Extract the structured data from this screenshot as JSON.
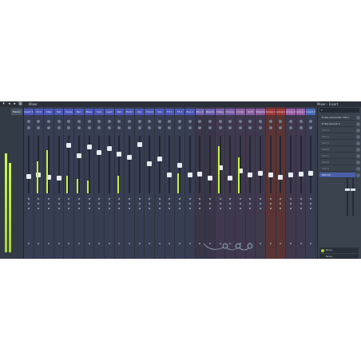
{
  "app": {
    "title": "Mixer",
    "fx_panel_title": "Mixer - Insert"
  },
  "master": {
    "label": "Master"
  },
  "tracks": [
    {
      "name": "Insert 1",
      "color": "#4a58b8",
      "fader": 0.28,
      "peak": 0.0
    },
    {
      "name": "Kick",
      "color": "#4a58b8",
      "fader": 0.3,
      "peak": 0.55
    },
    {
      "name": "Clap",
      "color": "#4a58b8",
      "fader": 0.26,
      "peak": 0.75
    },
    {
      "name": "Hat",
      "color": "#4a58b8",
      "fader": 0.25,
      "peak": 0.0
    },
    {
      "name": "Snare",
      "color": "#4a58b8",
      "fader": 0.86,
      "peak": 0.3
    },
    {
      "name": "Perc",
      "color": "#4a58b8",
      "fader": 0.66,
      "peak": 0.25
    },
    {
      "name": "Bass",
      "color": "#4a58b8",
      "fader": 0.84,
      "peak": 0.22
    },
    {
      "name": "Sub",
      "color": "#4a58b8",
      "fader": 0.72,
      "peak": 0.0
    },
    {
      "name": "Lead",
      "color": "#4a58b8",
      "fader": 0.81,
      "peak": 0.0
    },
    {
      "name": "Pad",
      "color": "#4a58b8",
      "fader": 0.7,
      "peak": 0.3
    },
    {
      "name": "Pluck",
      "color": "#4a58b8",
      "fader": 0.64,
      "peak": 0.0
    },
    {
      "name": "Arp",
      "color": "#4a58b8",
      "fader": 0.88,
      "peak": 0.0
    },
    {
      "name": "Chord",
      "color": "#4a58b8",
      "fader": 0.52,
      "peak": 0.0
    },
    {
      "name": "Vox",
      "color": "#4a58b8",
      "fader": 0.6,
      "peak": 0.0
    },
    {
      "name": "FX 1",
      "color": "#4a58b8",
      "fader": 0.3,
      "peak": 0.0
    },
    {
      "name": "FX 2",
      "color": "#4a58b8",
      "fader": 0.48,
      "peak": 0.35
    },
    {
      "name": "Bus 1",
      "color": "#4a58b8",
      "fader": 0.3,
      "peak": 0.0
    },
    {
      "name": "Bus 2",
      "color": "#6e5fb0",
      "fader": 0.32,
      "peak": 0.0
    },
    {
      "name": "Reverb",
      "color": "#6e5fb0",
      "fader": 0.24,
      "peak": 0.0
    },
    {
      "name": "Delay",
      "color": "#7a5fa8",
      "fader": 0.44,
      "peak": 0.82
    },
    {
      "name": "Chorus",
      "color": "#7a5fa8",
      "fader": 0.25,
      "peak": 0.0
    },
    {
      "name": "Comp",
      "color": "#8a5fa0",
      "fader": 0.38,
      "peak": 0.62
    },
    {
      "name": "Limit",
      "color": "#8a5fa0",
      "fader": 0.3,
      "peak": 0.0
    },
    {
      "name": "Sidechain",
      "color": "#8a5fa0",
      "fader": 0.34,
      "peak": 0.0
    },
    {
      "name": "Group 1",
      "color": "#a03a3a",
      "fader": 0.3,
      "peak": 0.0
    },
    {
      "name": "Group 2",
      "color": "#a03a3a",
      "fader": 0.26,
      "peak": 0.0
    },
    {
      "name": "Group 3",
      "color": "#9a5fa8",
      "fader": 0.3,
      "peak": 0.0
    },
    {
      "name": "Group 4",
      "color": "#9a5fa8",
      "fader": 0.32,
      "peak": 0.0
    },
    {
      "name": "Insert 29",
      "color": "#4a6ab8",
      "fader": 0.34,
      "peak": 0.0
    }
  ],
  "fx": {
    "slots": [
      {
        "label": "Fruity parametric EQ 2",
        "state": "active"
      },
      {
        "label": "Fruity Reverb 2",
        "state": "active"
      },
      {
        "label": "Slot 3",
        "state": "empty"
      },
      {
        "label": "Slot 4",
        "state": "empty"
      },
      {
        "label": "Slot 5",
        "state": "empty"
      },
      {
        "label": "Slot 6",
        "state": "empty"
      },
      {
        "label": "Slot 7",
        "state": "empty"
      },
      {
        "label": "Slot 8",
        "state": "empty"
      },
      {
        "label": "Slot 9",
        "state": "empty"
      },
      {
        "label": "Slot 10",
        "state": "selected"
      }
    ],
    "eq_label_1": "None",
    "eq_label_2": "None"
  },
  "colors": {
    "accent": "#c6f23e",
    "panel_bg": "#3b4450",
    "selection": "#4b5fa8"
  }
}
